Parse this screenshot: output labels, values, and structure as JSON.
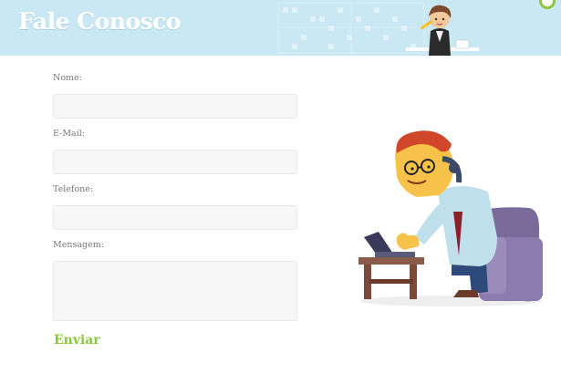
{
  "header": {
    "title": "Fale Conosco",
    "background_color": "#c9e8f4",
    "accent_color": "#8ec63f"
  },
  "form": {
    "fields": [
      {
        "label": "Nome:",
        "value": ""
      },
      {
        "label": "E-Mail:",
        "value": ""
      },
      {
        "label": "Telefone:",
        "value": ""
      },
      {
        "label": "Mensagem:",
        "value": ""
      }
    ],
    "submit_label": "Enviar",
    "submit_color": "#8cc63f"
  },
  "illustration": {
    "icon": "man-at-laptop-illustration"
  }
}
